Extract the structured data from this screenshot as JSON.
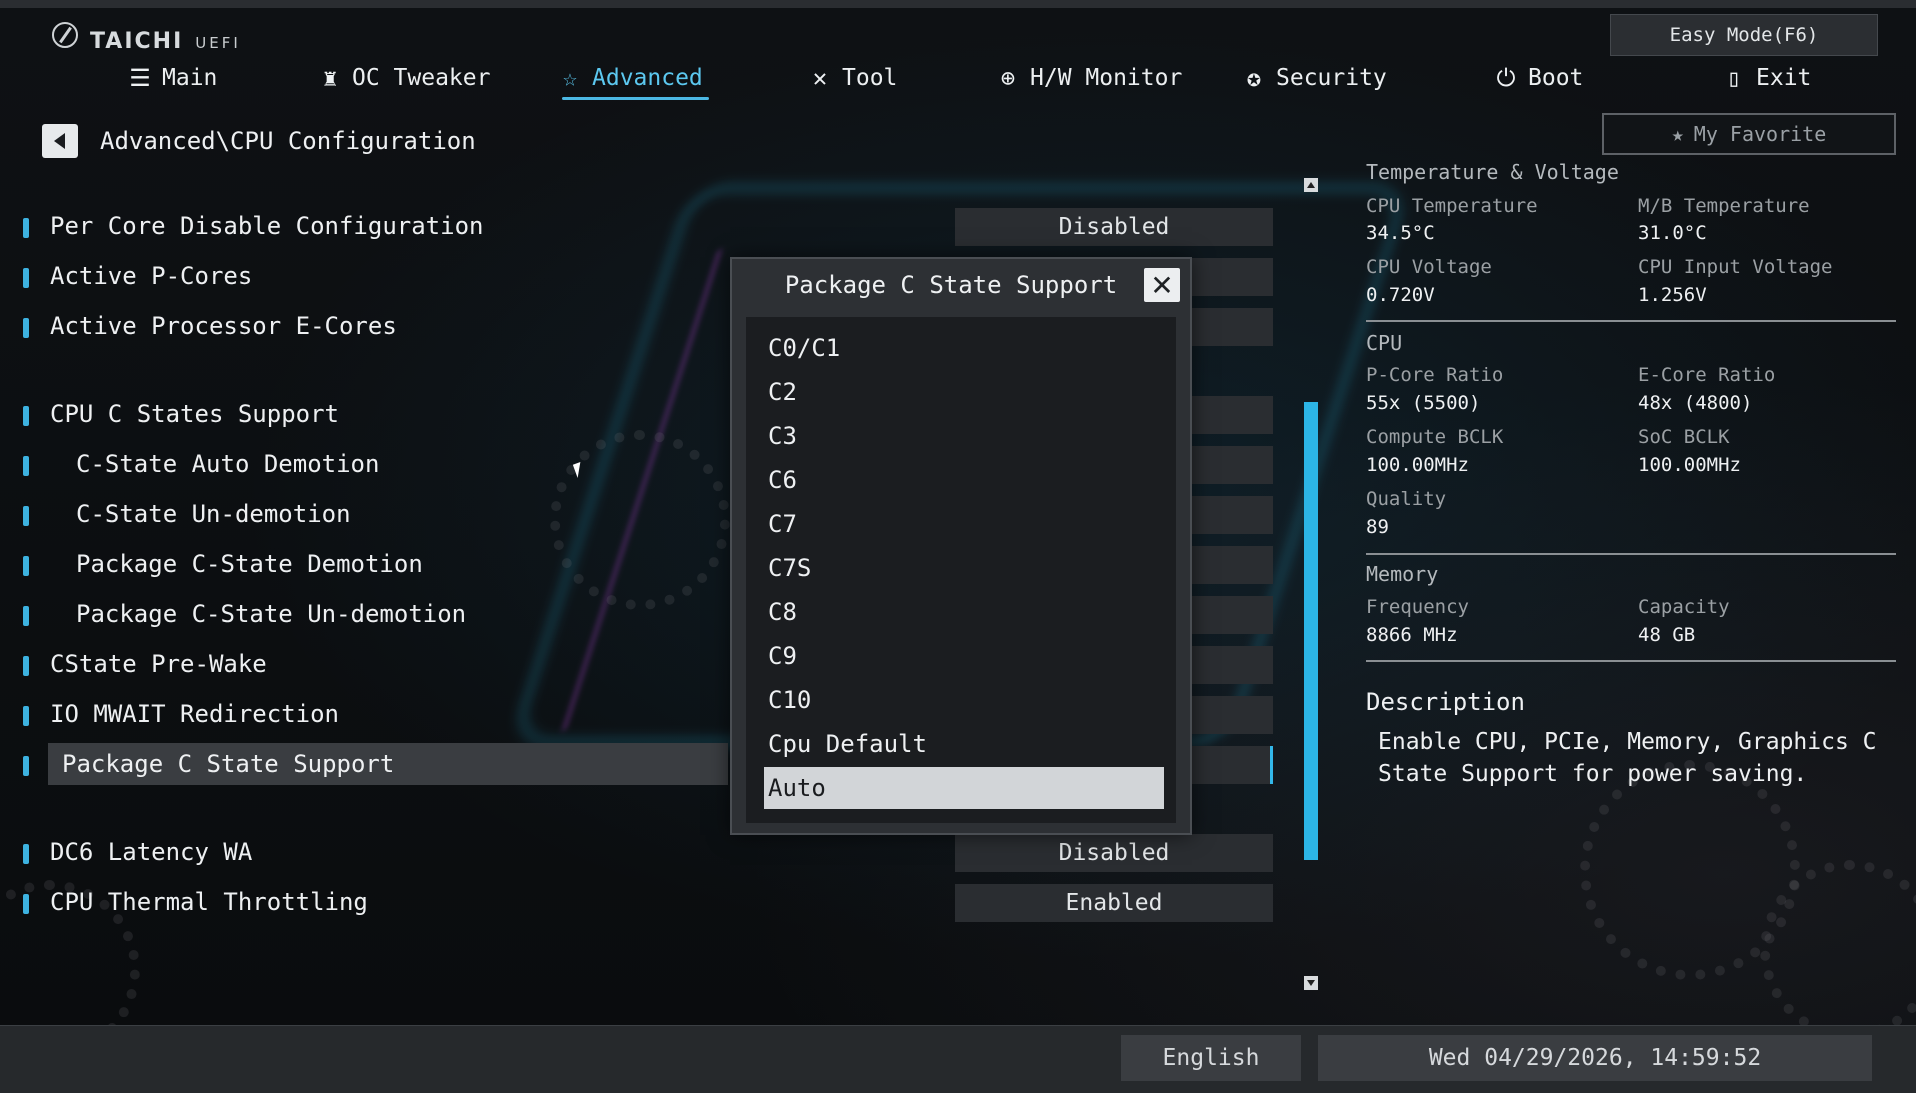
{
  "brand": {
    "name": "TAICHI",
    "sub": "UEFI"
  },
  "easy_mode_label": "Easy Mode(F6)",
  "nav": [
    {
      "label": "Main",
      "icon": "list-icon"
    },
    {
      "label": "OC Tweaker",
      "icon": "rocket-icon"
    },
    {
      "label": "Advanced",
      "icon": "star-icon",
      "active": true
    },
    {
      "label": "Tool",
      "icon": "tools-icon"
    },
    {
      "label": "H/W Monitor",
      "icon": "crosshair-icon"
    },
    {
      "label": "Security",
      "icon": "shield-icon"
    },
    {
      "label": "Boot",
      "icon": "power-icon"
    },
    {
      "label": "Exit",
      "icon": "exit-icon"
    }
  ],
  "my_favorite_label": "My Favorite",
  "breadcrumb": "Advanced\\CPU Configuration",
  "settings": [
    {
      "label": "Per Core Disable Configuration",
      "value": "Disabled"
    },
    {
      "label": "Active P-Cores",
      "value": ""
    },
    {
      "label": "Active Processor E-Cores",
      "value": ""
    },
    {
      "label": "CPU C States Support",
      "value": ""
    },
    {
      "label": "C-State Auto Demotion",
      "value": ""
    },
    {
      "label": "C-State Un-demotion",
      "value": ""
    },
    {
      "label": "Package C-State Demotion",
      "value": ""
    },
    {
      "label": "Package C-State Un-demotion",
      "value": ""
    },
    {
      "label": "CState Pre-Wake",
      "value": ""
    },
    {
      "label": "IO MWAIT Redirection",
      "value": ""
    },
    {
      "label": "Package C State Support",
      "value": "",
      "selected": true
    },
    {
      "label": "DC6 Latency WA",
      "value": "Disabled"
    },
    {
      "label": "CPU Thermal Throttling",
      "value": "Enabled"
    }
  ],
  "popup": {
    "title": "Package C State Support",
    "options": [
      "C0/C1",
      "C2",
      "C3",
      "C6",
      "C7",
      "C7S",
      "C8",
      "C9",
      "C10",
      "Cpu Default",
      "Auto"
    ],
    "selected": "Auto"
  },
  "hw": {
    "temp_voltage_title": "Temperature & Voltage",
    "cpu_temp_label": "CPU Temperature",
    "cpu_temp": "34.5°C",
    "mb_temp_label": "M/B Temperature",
    "mb_temp": "31.0°C",
    "cpu_volt_label": "CPU Voltage",
    "cpu_volt": "0.720V",
    "cpu_in_volt_label": "CPU Input Voltage",
    "cpu_in_volt": "1.256V",
    "cpu_title": "CPU",
    "pcore_label": "P-Core Ratio",
    "pcore": "55x (5500)",
    "ecore_label": "E-Core Ratio",
    "ecore": "48x (4800)",
    "bclk_label": "Compute BCLK",
    "bclk": "100.00MHz",
    "soc_label": "SoC BCLK",
    "soc": "100.00MHz",
    "quality_label": "Quality",
    "quality": "89",
    "memory_title": "Memory",
    "freq_label": "Frequency",
    "freq": "8866 MHz",
    "cap_label": "Capacity",
    "cap": "48 GB"
  },
  "description": {
    "title": "Description",
    "text": "Enable CPU, PCIe, Memory, Graphics C State Support for power saving."
  },
  "language": "English",
  "datetime": "Wed 04/29/2026, 14:59:52",
  "colors": {
    "accent": "#33b8ea",
    "panel": "#2a2d31",
    "background": "#0b0d10"
  }
}
